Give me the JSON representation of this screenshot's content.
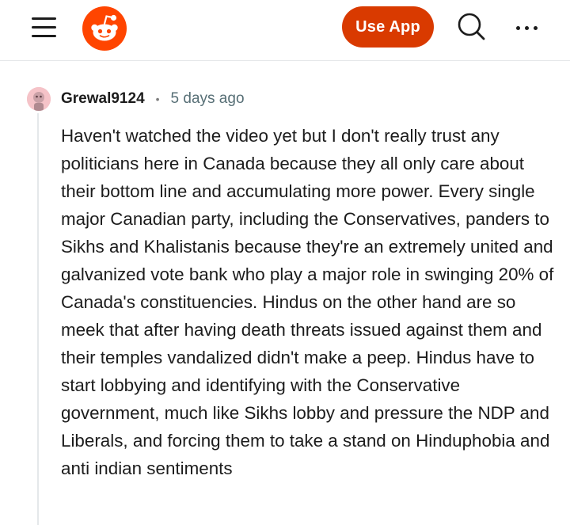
{
  "header": {
    "menu_icon": "hamburger-menu-icon",
    "logo_icon": "reddit-snoo-logo",
    "use_app_label": "Use App",
    "search_icon": "search-icon",
    "more_icon": "more-horizontal-icon",
    "brand_color": "#ff4500",
    "button_color": "#d93a00"
  },
  "comment": {
    "avatar_icon": "user-avatar",
    "username": "Grewal9124",
    "separator": "•",
    "timestamp": "5 days ago",
    "body": "Haven't watched the video yet but I don't really trust any politicians here in Canada because they all only care about their bottom line and accumulating more power. Every single major Canadian party, including the Conservatives, panders to Sikhs and Khalistanis because they're an extremely united and galvanized vote bank who play a major role in swinging 20% of Canada's constituencies. Hindus on the other hand are so meek that after having death threats issued against them and their temples vandalized didn't make a peep. Hindus have to start lobbying and identifying with the Conservative government, much like Sikhs lobby and pressure the NDP and Liberals, and forcing them to take a stand on Hinduphobia and anti indian sentiments"
  }
}
